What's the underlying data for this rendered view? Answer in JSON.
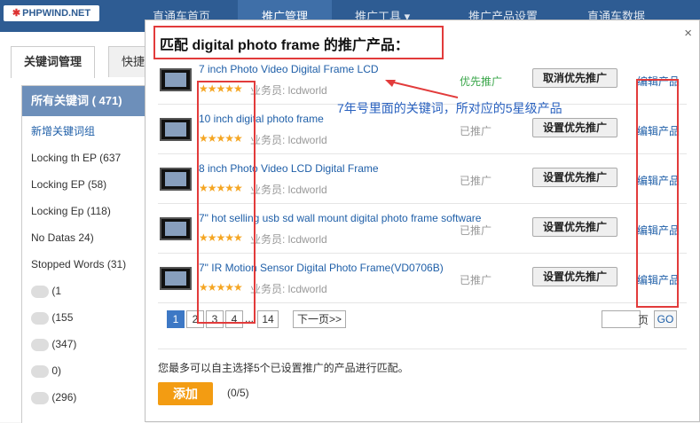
{
  "logo": "PHPWIND.NET",
  "nav": [
    "直通车首页",
    "推广管理",
    "推广工具 ▾",
    "推广产品设置",
    "直通车数据"
  ],
  "left": {
    "tabs": [
      "关键词管理",
      "快捷"
    ],
    "all_keywords": "所有关键词 ( 471)",
    "new_group": "新增关键词组",
    "items": [
      "Locking   th EP (637",
      "Locking    EP (58)",
      "Locking    Ep (118)",
      "No Datas   24)",
      "Stopped Words (31)",
      "(1",
      "(155",
      "(347)",
      "0)",
      "(296)"
    ]
  },
  "dialog": {
    "title": "匹配 digital photo frame 的推广产品：",
    "close": "×",
    "owner_label": "业务员: lcdworld",
    "stars": "★★★★★",
    "products": [
      {
        "name": "7 inch Photo Video Digital Frame LCD",
        "status": "优先推广",
        "status_type": "priority",
        "action": "取消优先推广",
        "edit": "编辑产品"
      },
      {
        "name": "10 inch digital photo frame",
        "status": "已推广",
        "status_type": "normal",
        "action": "设置优先推广",
        "edit": "编辑产品"
      },
      {
        "name": "8 inch Photo Video LCD Digital Frame",
        "status": "已推广",
        "status_type": "normal",
        "action": "设置优先推广",
        "edit": "编辑产品"
      },
      {
        "name": "7\" hot selling usb sd wall mount digital photo frame software",
        "status": "已推广",
        "status_type": "normal",
        "action": "设置优先推广",
        "edit": "编辑产品"
      },
      {
        "name": "7\" IR Motion Sensor Digital Photo Frame(VD0706B)",
        "status": "已推广",
        "status_type": "normal",
        "action": "设置优先推广",
        "edit": "编辑产品"
      }
    ],
    "annotation": "7年号里面的关键词，所对应的5星级产品",
    "pagination": {
      "pages": [
        "1",
        "2",
        "3",
        "4"
      ],
      "current": "1",
      "ellipsis": "...",
      "last": "14",
      "next": "下一页>>",
      "page_label": "页",
      "go": "GO"
    },
    "note": "您最多可以自主选择5个已设置推广的产品进行匹配。",
    "add_button": "添加",
    "count": "(0/5)"
  },
  "colors": {
    "nav": "#2e5c93",
    "link": "#1f5fa8",
    "highlight": "#e23b3b",
    "accent": "#f39c12",
    "priority": "#3aa64a"
  }
}
